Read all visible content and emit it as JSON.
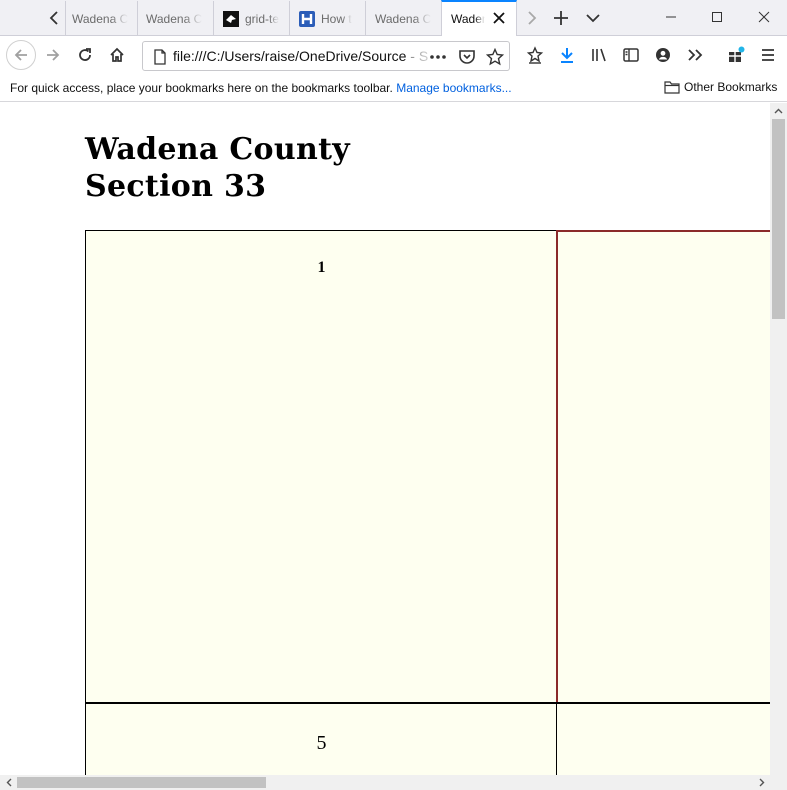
{
  "tabs": [
    {
      "title": "Wadena C",
      "active": false,
      "icon": "none"
    },
    {
      "title": "Wadena C",
      "active": false,
      "icon": "none"
    },
    {
      "title": "grid-te",
      "active": false,
      "icon": "github-icon"
    },
    {
      "title": "How t",
      "active": false,
      "icon": "h-logo-icon"
    },
    {
      "title": "Wadena C",
      "active": false,
      "icon": "none"
    },
    {
      "title": "Waden",
      "active": true,
      "icon": "none"
    }
  ],
  "nav": {
    "url_main": "file:///C:/Users/raise/OneDrive/Source",
    "url_tail": " - S"
  },
  "bookmarks_bar": {
    "hint": "For quick access, place your bookmarks here on the bookmarks toolbar.",
    "manage_link": "Manage bookmarks...",
    "other_bookmarks": "Other Bookmarks"
  },
  "page": {
    "title_line1": "Wadena County",
    "title_line2": "Section 33",
    "cells": [
      {
        "label": "1",
        "highlighted": false
      },
      {
        "label": "",
        "highlighted": true
      },
      {
        "label": "5",
        "highlighted": false
      },
      {
        "label": "",
        "highlighted": false
      }
    ]
  },
  "colors": {
    "cell_fill": "#fefff0",
    "highlight_border": "#8b2a2a",
    "accent": "#0a84ff",
    "link": "#0060df"
  }
}
